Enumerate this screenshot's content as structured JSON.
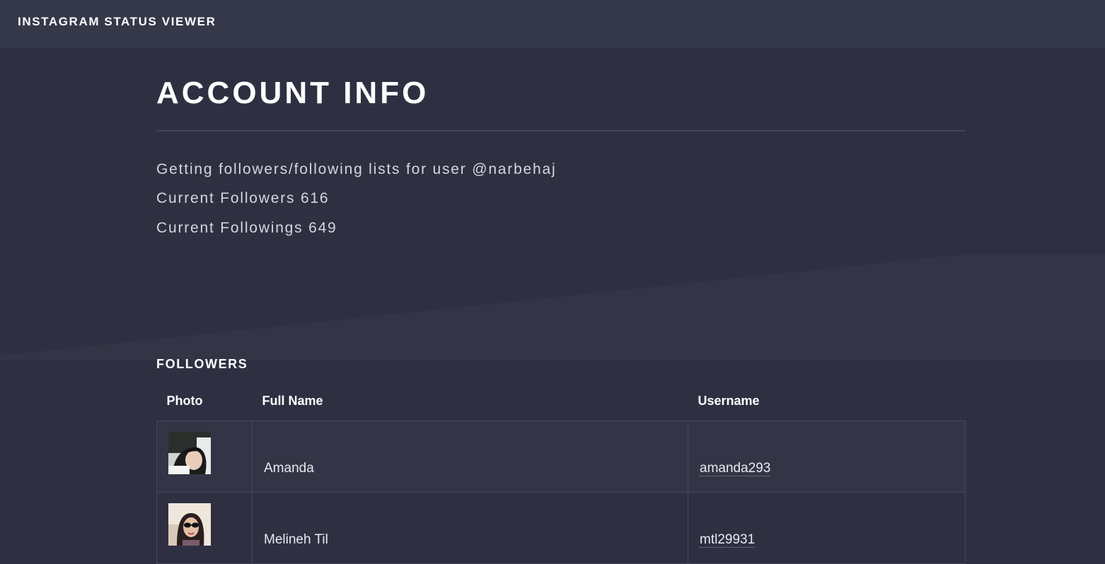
{
  "header": {
    "brand": "INSTAGRAM STATUS VIEWER"
  },
  "account": {
    "title": "ACCOUNT INFO",
    "status_line": "Getting followers/following lists for user @narbehaj",
    "followers_line": "Current Followers 616",
    "followings_line": "Current Followings 649"
  },
  "followers": {
    "title": "FOLLOWERS",
    "columns": [
      "Photo",
      "Full Name",
      "Username"
    ],
    "rows": [
      {
        "full_name": "Amanda",
        "username": "amanda293",
        "photo_icon": "profile-photo"
      },
      {
        "full_name": "Melineh Til",
        "username": "mtl29931",
        "photo_icon": "profile-photo"
      }
    ]
  },
  "colors": {
    "background": "#2e3042",
    "topbar": "#353849",
    "row_odd": "#333546",
    "border": "#45485b"
  }
}
